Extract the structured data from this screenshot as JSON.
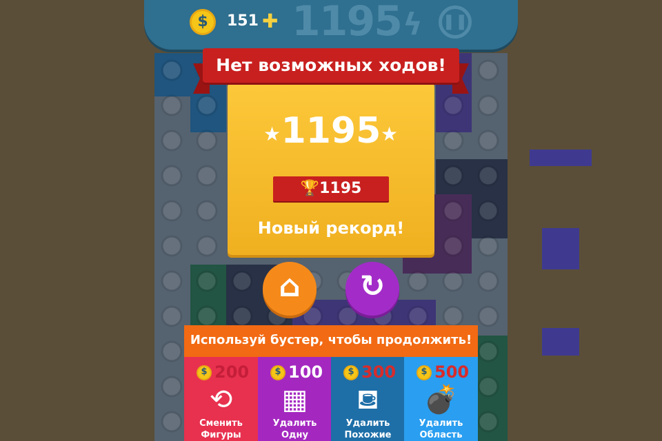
{
  "hud": {
    "coins": "151",
    "coin_symbol": "$",
    "plus_symbol": "✚",
    "score": "1195",
    "bolt_symbol": "ϟ",
    "pause_symbol": "❚❚"
  },
  "game_over": {
    "title": "Нет возможных ходов!",
    "score": "1195",
    "star_left": "★",
    "star_right": "★",
    "trophy": "🏆",
    "best_score": "1195",
    "new_record": "Новый рекорд!",
    "home_icon": "⌂",
    "restart_icon": "↻"
  },
  "boosters": {
    "prompt": "Используй бустер, чтобы продолжить!",
    "items": [
      {
        "price": "200",
        "icon": "⟲",
        "label1": "Сменить",
        "label2": "Фигуры",
        "color": "#e8314f",
        "price_color": "#c41e3a"
      },
      {
        "price": "100",
        "icon": "▦",
        "label1": "Удалить",
        "label2": "Одну",
        "color": "#a428c0",
        "price_color": "#ffffff"
      },
      {
        "price": "300",
        "icon": "⛾",
        "label1": "Удалить",
        "label2": "Похожие",
        "color": "#1e6fa8",
        "price_color": "#d92b2b"
      },
      {
        "price": "500",
        "icon": "💣",
        "label1": "Удалить",
        "label2": "Область",
        "color": "#2a9ef0",
        "price_color": "#d92b2b"
      }
    ]
  },
  "colors": {
    "background": "#5a4e38",
    "hud": "#2f6f8f",
    "ribbon": "#c8201f",
    "panel": "#f8be2e",
    "prompt": "#f26a13"
  }
}
